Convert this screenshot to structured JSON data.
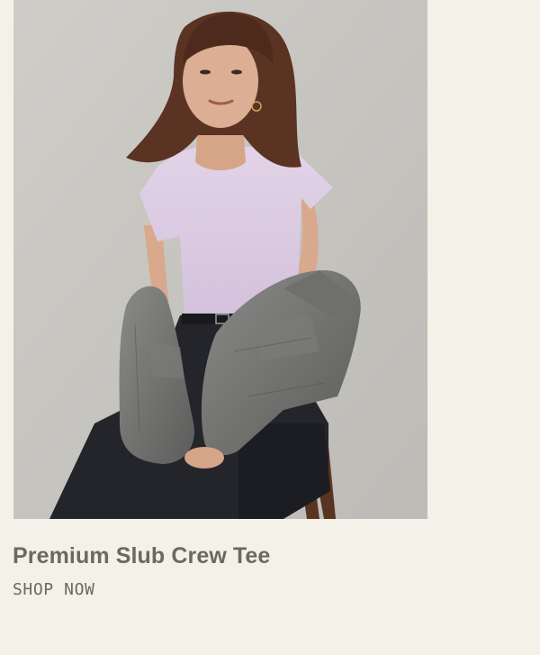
{
  "product": {
    "image_alt": "Model wearing a lavender crew tee with a grey denim jacket draped around her arms, seated on a wooden stool",
    "title": "Premium Slub Crew Tee",
    "cta_label": "SHOP NOW"
  },
  "colors": {
    "page_background": "#f4f1e8",
    "photo_backdrop": "#c9c7c2",
    "text": "#6b6962"
  }
}
